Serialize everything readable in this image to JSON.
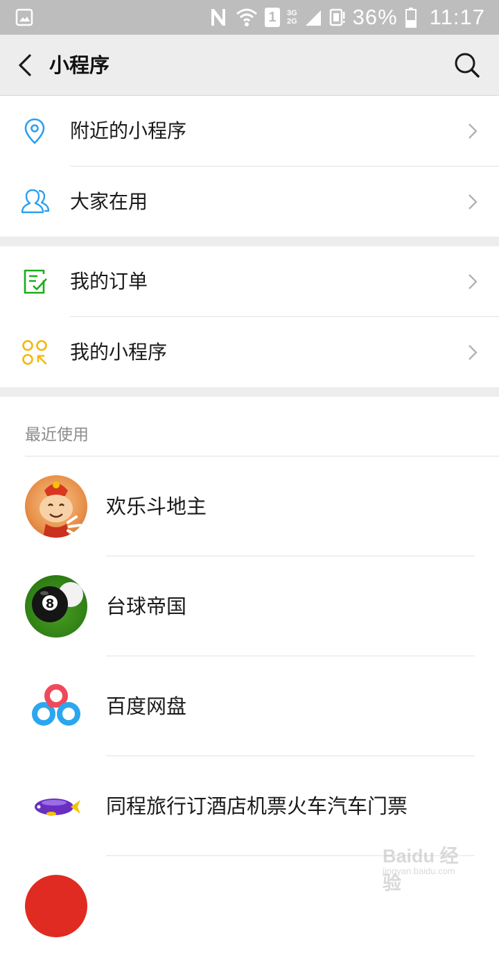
{
  "status_bar": {
    "battery": "36%",
    "time": "11:17",
    "network_up": "3G",
    "network_down": "2G",
    "sim": "1",
    "icons": [
      "gallery-icon",
      "nfc-icon",
      "wifi-icon",
      "sim-icon",
      "signal-icon",
      "data-saver-icon",
      "battery-icon"
    ]
  },
  "header": {
    "title": "小程序",
    "icons": [
      "back-icon",
      "search-icon"
    ]
  },
  "menu_group_1": {
    "items": [
      {
        "label": "附近的小程序",
        "icon": "location-pin-icon",
        "color": "#2aa0f0"
      },
      {
        "label": "大家在用",
        "icon": "people-icon",
        "color": "#2aa0f0"
      }
    ]
  },
  "menu_group_2": {
    "items": [
      {
        "label": "我的订单",
        "icon": "order-checklist-icon",
        "color": "#1aad19"
      },
      {
        "label": "我的小程序",
        "icon": "my-apps-icon",
        "color": "#f5b800"
      }
    ]
  },
  "recent": {
    "title": "最近使用",
    "items": [
      {
        "label": "欢乐斗地主",
        "icon": "doudizhu-avatar"
      },
      {
        "label": "台球帝国",
        "icon": "billiards-avatar"
      },
      {
        "label": "百度网盘",
        "icon": "baidu-netdisk-logo"
      },
      {
        "label": "同程旅行订酒店机票火车汽车门票",
        "icon": "tongcheng-blimp-logo"
      },
      {
        "label": "",
        "icon": "red-avatar"
      }
    ]
  },
  "watermark": {
    "text": "Baidu 经验",
    "sub": "jingyan.baidu.com"
  }
}
